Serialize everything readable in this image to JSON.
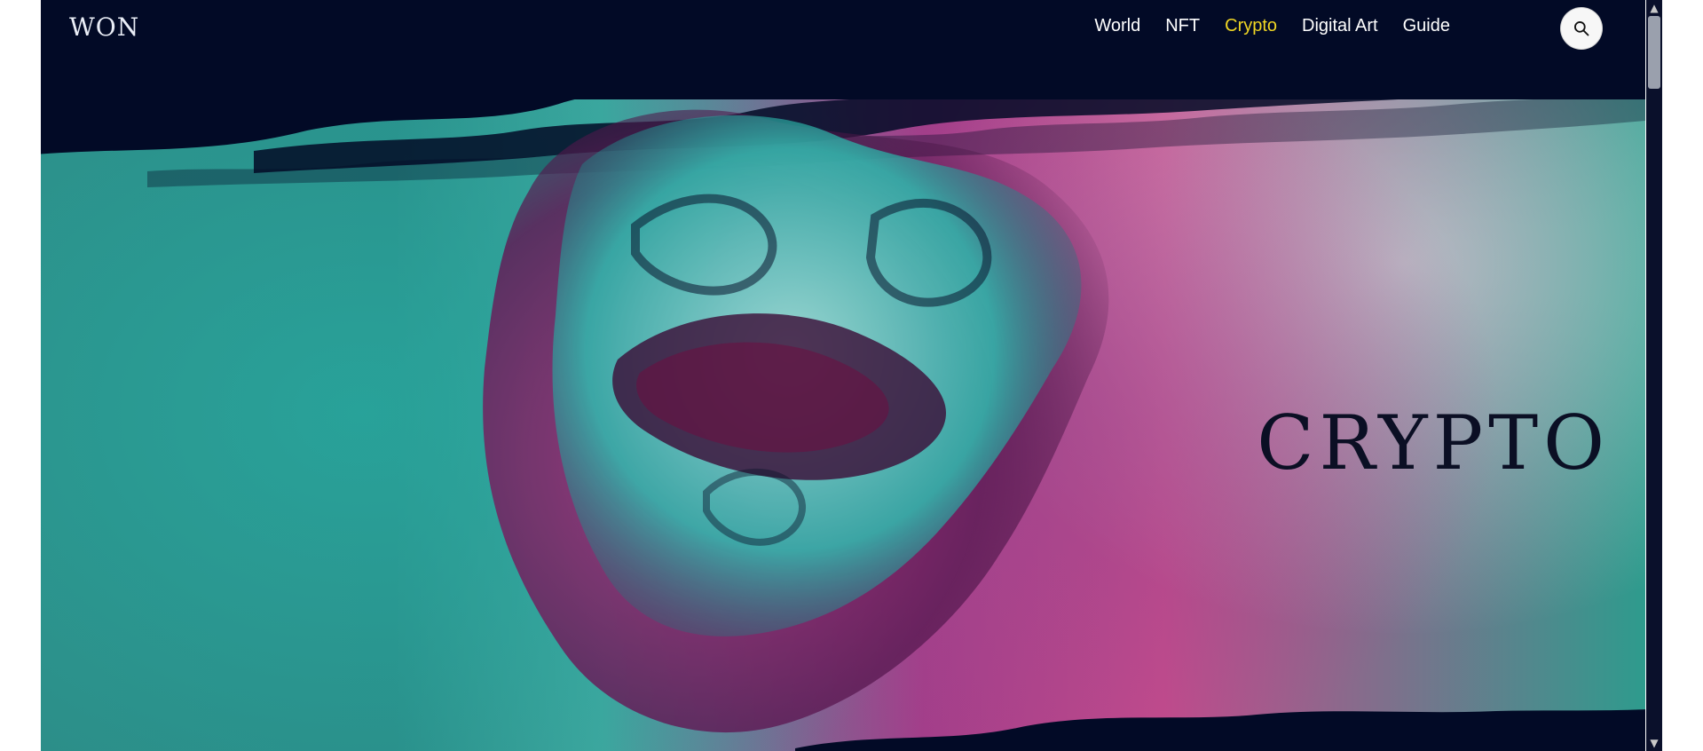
{
  "header": {
    "logo": "WON",
    "nav": [
      "World",
      "NFT",
      "Crypto",
      "Digital Art",
      "Guide"
    ],
    "active_nav": "Crypto"
  },
  "hero": {
    "title": "CRYPTO"
  },
  "icons": {
    "search": "search-icon"
  },
  "colors": {
    "navbar_bg": "#020a26",
    "nav_text": "#ffffff",
    "nav_active": "#f0d624",
    "hero_title": "#0b0f24",
    "scrollbar_track": "#0a102b",
    "scrollbar_thumb": "#9aa0ad"
  }
}
